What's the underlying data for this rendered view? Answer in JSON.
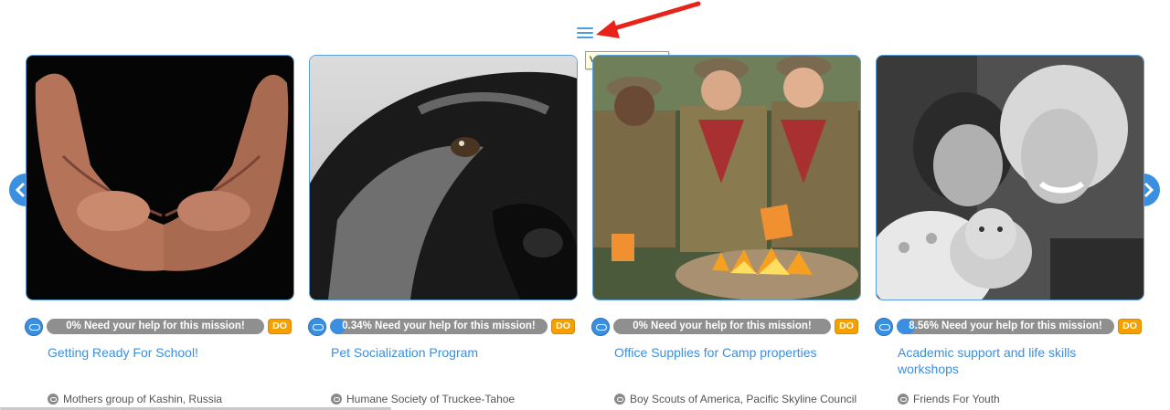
{
  "header": {
    "menu_icon": "hamburger-menu-icon",
    "tooltip": "View all wishlists",
    "annotation_color": "#e8241a"
  },
  "carousel": {
    "prev_icon": "chevron-left-icon",
    "next_icon": "chevron-right-icon",
    "accent_color": "#3b8fe0",
    "do_color": "#f5a000",
    "cards": [
      {
        "image": "cupped-hands-photo",
        "progress_percent": 0,
        "progress_text": "0% Need your help for this mission!",
        "do_label": "DO",
        "title": "Getting Ready For School!",
        "org": "Mothers group of Kashin, Russia"
      },
      {
        "image": "dog-close-up-photo",
        "progress_percent": 0.34,
        "progress_text": "0.34% Need your help for this mission!",
        "do_label": "DO",
        "title": "Pet Socialization Program",
        "org": "Humane Society of Truckee-Tahoe"
      },
      {
        "image": "boy-scouts-campfire-photo",
        "progress_percent": 0,
        "progress_text": "0% Need your help for this mission!",
        "do_label": "DO",
        "title": "Office Supplies for Camp properties",
        "org": "Boy Scouts of America, Pacific Skyline Council"
      },
      {
        "image": "girl-and-woman-with-plush-photo",
        "progress_percent": 8.56,
        "progress_text": "8.56% Need your help for this mission!",
        "do_label": "DO",
        "title": "Academic support and life skills workshops",
        "org": "Friends For Youth"
      }
    ]
  }
}
